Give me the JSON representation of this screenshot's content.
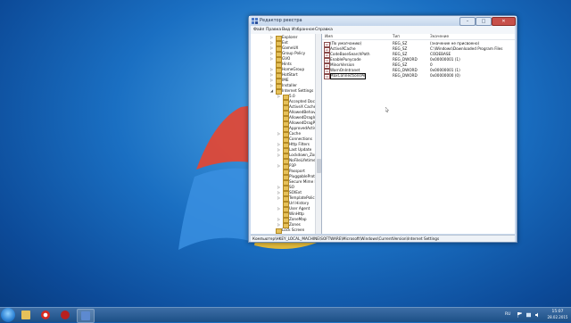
{
  "window": {
    "title": "Редактор реестра",
    "minimize": "–",
    "maximize": "□",
    "close": "✕"
  },
  "menu": [
    "Файл",
    "Правка",
    "Вид",
    "Избранное",
    "Справка"
  ],
  "tree": {
    "items": [
      {
        "label": "Explorer",
        "expandable": true
      },
      {
        "label": "Ext",
        "expandable": true
      },
      {
        "label": "GameUX",
        "expandable": true
      },
      {
        "label": "Group Policy",
        "expandable": true
      },
      {
        "label": "GVO",
        "expandable": true
      },
      {
        "label": "Hints",
        "expandable": false
      },
      {
        "label": "HomeGroup",
        "expandable": true
      },
      {
        "label": "HotStart",
        "expandable": true
      },
      {
        "label": "IME",
        "expandable": true
      },
      {
        "label": "Installer",
        "expandable": true
      },
      {
        "label": "Internet Settings",
        "expandable": true,
        "expanded": true
      },
      {
        "label": "5.0",
        "expandable": true,
        "indent": true
      },
      {
        "label": "Accepted Document",
        "expandable": false,
        "indent": true
      },
      {
        "label": "ActiveX Cache",
        "expandable": false,
        "indent": true
      },
      {
        "label": "AllowedBehaviors",
        "expandable": false,
        "indent": true
      },
      {
        "label": "AllowedDragImageE",
        "expandable": false,
        "indent": true
      },
      {
        "label": "AllowedDragProtoc",
        "expandable": false,
        "indent": true
      },
      {
        "label": "ApprovedActiveXIn",
        "expandable": false,
        "indent": true
      },
      {
        "label": "Cache",
        "expandable": true,
        "indent": true
      },
      {
        "label": "Connections",
        "expandable": false,
        "indent": true
      },
      {
        "label": "Http Filters",
        "expandable": true,
        "indent": true
      },
      {
        "label": "Last Update",
        "expandable": true,
        "indent": true
      },
      {
        "label": "Lockdown_Zones",
        "expandable": true,
        "indent": true
      },
      {
        "label": "NoFileLifetimeExte",
        "expandable": false,
        "indent": true
      },
      {
        "label": "P3P",
        "expandable": true,
        "indent": true
      },
      {
        "label": "Passport",
        "expandable": false,
        "indent": true
      },
      {
        "label": "PluggableProtocols",
        "expandable": false,
        "indent": true
      },
      {
        "label": "Secure Mime Handle",
        "expandable": false,
        "indent": true
      },
      {
        "label": "SO",
        "expandable": true,
        "indent": true
      },
      {
        "label": "SOIExt",
        "expandable": true,
        "indent": true
      },
      {
        "label": "TemplatePolicies",
        "expandable": true,
        "indent": true
      },
      {
        "label": "Url History",
        "expandable": false,
        "indent": true
      },
      {
        "label": "User Agent",
        "expandable": true,
        "indent": true
      },
      {
        "label": "WinHttp",
        "expandable": false,
        "indent": true
      },
      {
        "label": "ZoneMap",
        "expandable": true,
        "indent": true
      },
      {
        "label": "Zones",
        "expandable": true,
        "indent": true
      },
      {
        "label": "Lock Screen",
        "expandable": false,
        "indent": false
      }
    ]
  },
  "columns": {
    "name": "Имя",
    "type": "Тип",
    "data": "Значение"
  },
  "values": [
    {
      "icon": "ab",
      "name": "(По умолчанию)",
      "type": "REG_SZ",
      "data": "(значение не присвоено)"
    },
    {
      "icon": "ab",
      "name": "ActiveXCache",
      "type": "REG_SZ",
      "data": "C:\\Windows\\Downloaded Program Files"
    },
    {
      "icon": "ab",
      "name": "CodeBaseSearchPath",
      "type": "REG_SZ",
      "data": "CODEBASE"
    },
    {
      "icon": "01",
      "name": "EnablePunycode",
      "type": "REG_DWORD",
      "data": "0x00000001 (1)"
    },
    {
      "icon": "ab",
      "name": "MinorVersion",
      "type": "REG_SZ",
      "data": "0"
    },
    {
      "icon": "01",
      "name": "WarnOnIntranet",
      "type": "REG_DWORD",
      "data": "0x00000001 (1)"
    },
    {
      "icon": "01",
      "name": "MaxConnectionsPe",
      "type": "REG_DWORD",
      "data": "0x00000000 (0)",
      "editing": true
    }
  ],
  "status": "Компьютер\\HKEY_LOCAL_MACHINE\\SOFTWARE\\Microsoft\\Windows\\CurrentVersion\\Internet Settings",
  "taskbar": {
    "apps": [
      "start-orb",
      "explorer",
      "opera",
      "media-player",
      "regedit"
    ],
    "language": "RU",
    "time": "15:07",
    "date": "28.02.2015"
  }
}
